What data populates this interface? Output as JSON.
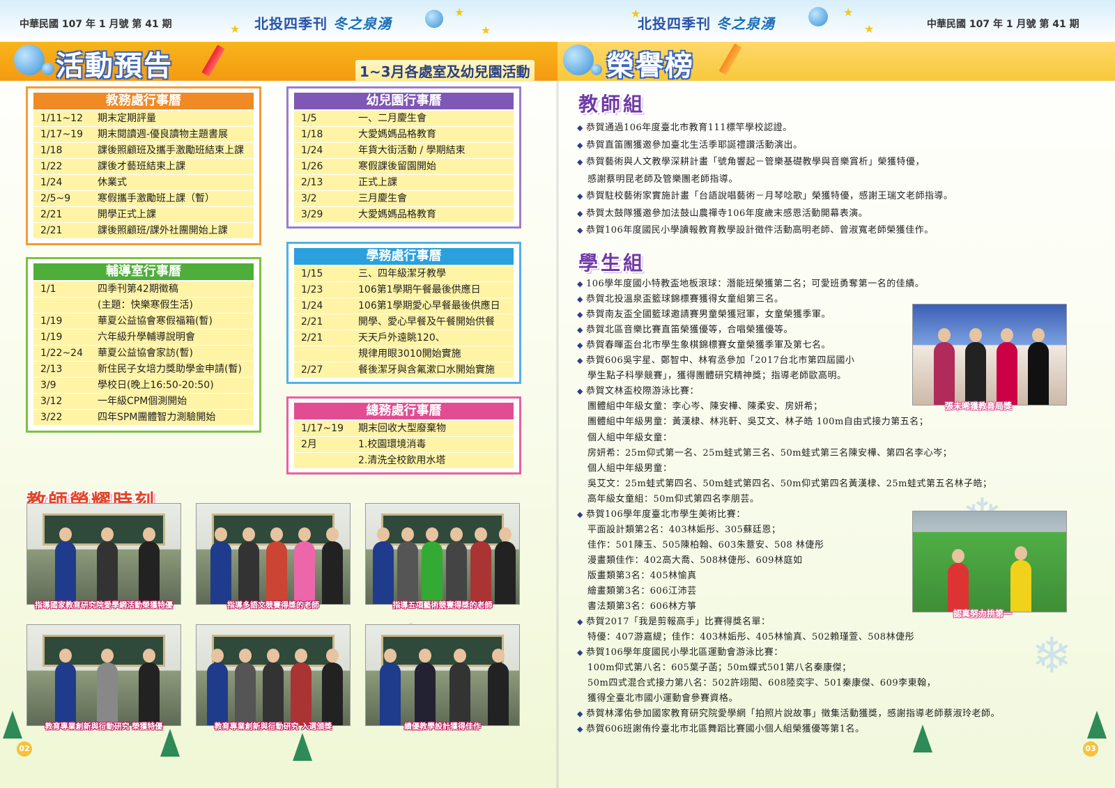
{
  "header": {
    "issue": "中華民國 107 年 1 月號 第 41 期",
    "magazine": "北投四季刊",
    "magazine_sub": "冬之泉湧"
  },
  "left": {
    "banner_title": "活動預告",
    "banner_sub": "1~3月各處室及幼兒園活動",
    "calendars": {
      "jiaowu": {
        "title": "教務處行事曆",
        "rows": [
          {
            "d": "1/11~12",
            "e": "期末定期評量"
          },
          {
            "d": "1/17~19",
            "e": "期末閱讀週-優良讀物主題書展"
          },
          {
            "d": "1/18",
            "e": "課後照顧班及攜手激勵班結束上課"
          },
          {
            "d": "1/22",
            "e": "課後才藝班結束上課"
          },
          {
            "d": "1/24",
            "e": "休業式"
          },
          {
            "d": "2/5~9",
            "e": "寒假攜手激勵班上課（暫）"
          },
          {
            "d": "2/21",
            "e": "開學正式上課"
          },
          {
            "d": "2/21",
            "e": "課後照顧班/課外社團開始上課"
          }
        ]
      },
      "fudao": {
        "title": "輔導室行事曆",
        "rows": [
          {
            "d": "1/1",
            "e": "四季刊第42期徵稿"
          },
          {
            "d": "",
            "e": "(主題：快樂寒假生活)"
          },
          {
            "d": "1/19",
            "e": "華夏公益協會寒假福箱(暫)"
          },
          {
            "d": "1/19",
            "e": "六年級升學輔導說明會"
          },
          {
            "d": "1/22~24",
            "e": "華夏公益協會家訪(暫)"
          },
          {
            "d": "2/13",
            "e": "新住民子女培力獎助學金申請(暫)"
          },
          {
            "d": "3/9",
            "e": "學校日(晚上16:50-20:50)"
          },
          {
            "d": "3/12",
            "e": "一年級CPM個測開始"
          },
          {
            "d": "3/22",
            "e": "四年SPM團體智力測驗開始"
          }
        ]
      },
      "youer": {
        "title": "幼兒園行事曆",
        "rows": [
          {
            "d": "1/5",
            "e": "一、二月慶生會"
          },
          {
            "d": "1/18",
            "e": "大愛媽媽品格教育"
          },
          {
            "d": "1/24",
            "e": "年貨大街活動 / 學期結束"
          },
          {
            "d": "1/26",
            "e": "寒假課後留園開始"
          },
          {
            "d": "2/13",
            "e": "正式上課"
          },
          {
            "d": "3/2",
            "e": "三月慶生會"
          },
          {
            "d": "3/29",
            "e": "大愛媽媽品格教育"
          }
        ]
      },
      "xuewu": {
        "title": "學務處行事曆",
        "rows": [
          {
            "d": "1/15",
            "e": "三、四年級潔牙教學"
          },
          {
            "d": "1/23",
            "e": "106第1學期午餐最後供應日"
          },
          {
            "d": "1/24",
            "e": "106第1學期愛心早餐最後供應日"
          },
          {
            "d": "2/21",
            "e": "開學、愛心早餐及午餐開始供餐"
          },
          {
            "d": "2/21",
            "e": "天天戶外遠眺120、"
          },
          {
            "d": "",
            "e": "規律用眼3010開始實施"
          },
          {
            "d": "2/27",
            "e": "餐後潔牙與含氟漱口水開始實施"
          }
        ]
      },
      "zongwu": {
        "title": "總務處行事曆",
        "rows": [
          {
            "d": "1/17~19",
            "e": "期末回收大型廢棄物"
          },
          {
            "d": "2月",
            "e": "1.校園環境消毒"
          },
          {
            "d": "",
            "e": "2.清洗全校飲用水塔"
          }
        ]
      }
    },
    "honor_title": "教師榮耀時刻",
    "photos": [
      {
        "caption": "指導國家教育研究院愛學網活動榮獲特優"
      },
      {
        "caption": "指導多語文競賽得獎的老師"
      },
      {
        "caption": "指導五項藝術競賽得獎的老師"
      },
      {
        "caption": "教育專業創新與行動研究 榮獲特優"
      },
      {
        "caption": "教育專業創新與行動研究 入選頒獎"
      },
      {
        "caption": "績優教學設計獲得佳作"
      }
    ],
    "page_number": "02"
  },
  "right": {
    "banner_title": "榮譽榜",
    "teacher_title": "教師組",
    "teacher_lines": [
      {
        "t": "恭賀通過106年度臺北市教育111標竿學校認證。",
        "b": true
      },
      {
        "t": "恭賀直笛團獲邀參加臺北生活季耶誕禮讚活動演出。",
        "b": true
      },
      {
        "t": "恭賀藝術與人文教學深耕計畫「號角響起－管樂基礎教學與音樂賞析」榮獲特優，",
        "b": true
      },
      {
        "t": "感謝蔡明昆老師及管樂團老師指導。",
        "b": false
      },
      {
        "t": "恭賀駐校藝術家實施計畫「台語說唱藝術－月琴唸歌」榮獲特優，感謝王瑞文老師指導。",
        "b": true
      },
      {
        "t": "恭賀太鼓隊獲邀參加法鼓山農禪寺106年度歲末感恩活動開幕表演。",
        "b": true
      },
      {
        "t": "恭賀106年度國民小學讀報教育教學設計徵件活動高明老師、曾淑寬老師榮獲佳作。",
        "b": true
      }
    ],
    "student_title": "學生組",
    "student_lines": [
      {
        "t": "106學年度國小特教盃地板滾球：潛能班榮獲第二名；可愛班勇奪第一名的佳績。",
        "b": true
      },
      {
        "t": "恭賀北投溫泉盃籃球錦標賽獲得女童組第三名。",
        "b": true
      },
      {
        "t": "恭賀南友盃全國籃球邀請賽男童榮獲冠軍，女童榮獲季軍。",
        "b": true
      },
      {
        "t": "恭賀北區音樂比賽直笛榮獲優等，合唱榮獲優等。",
        "b": true
      },
      {
        "t": "恭賀春暉盃台北市學生象棋錦標賽女童榮獲季軍及第七名。",
        "b": true
      },
      {
        "t": "恭賀606吳宇星、鄭智中、林宥丞參加「2017台北市第四屆國小",
        "b": true
      },
      {
        "t": "學生點子科學競賽」，獲得團體研究精神獎；指導老師歐高明。",
        "b": false
      },
      {
        "t": "恭賀文林盃校際游泳比賽：",
        "b": true
      },
      {
        "t": "團體組中年級女童：李心岑、陳安樺、陳柔安、房妍希；",
        "b": false
      },
      {
        "t": "團體組中年級男童：黃漢棣、林兆軒、吳艾文、林子皓 100m自由式接力第五名；",
        "b": false
      },
      {
        "t": "個人組中年級女童：",
        "b": false
      },
      {
        "t": "房妍希：25m仰式第一名、25m蛙式第三名、50m蛙式第三名陳安樺、第四名李心岑；",
        "b": false
      },
      {
        "t": "個人組中年級男童：",
        "b": false
      },
      {
        "t": "吳艾文：25m蛙式第四名、50m蛙式第四名、50m仰式第四名黃漢棣、25m蛙式第五名林子皓；",
        "b": false
      },
      {
        "t": "高年級女童組：50m仰式第四名李朋芸。",
        "b": false
      },
      {
        "t": "恭賀106學年度臺北市學生美術比賽：",
        "b": true
      },
      {
        "t": "平面設計類第2名：403林姤彤、305蘇廷恩；",
        "b": false
      },
      {
        "t": "佳作：501陳玉、505陳柏翰、603朱薏安、508 林倢彤",
        "b": false
      },
      {
        "t": "漫畫類佳作：402高大喬、508林倢彤、609林庭如",
        "b": false
      },
      {
        "t": "版畫類第3名：405林愉真",
        "b": false
      },
      {
        "t": "繪畫類第3名：606江沛芸",
        "b": false
      },
      {
        "t": "書法類第3名：606林方箏",
        "b": false
      },
      {
        "t": "恭賀2017「我是剪報高手」比賽得獎名單：",
        "b": true
      },
      {
        "t": "特優：407游嘉緹；佳作：403林姤彤、405林愉真、502賴瑾萱、508林倢彤",
        "b": false
      },
      {
        "t": "恭賀106學年度國民小學北區運動會游泳比賽：",
        "b": true
      },
      {
        "t": "100m仰式第八名：605葉子菡；50m蝶式501第八名秦康傑；",
        "b": false
      },
      {
        "t": "50m四式混合式接力第八名：502許翊閎、608陸奕宇、501秦康傑、609李東翰，",
        "b": false
      },
      {
        "t": "獲得全臺北市國小運動會參賽資格。",
        "b": false
      },
      {
        "t": "恭賀林澤佑參加國家教育研究院愛學網「拍照片說故事」徵集活動獲獎，感謝指導老師蔡淑玲老師。",
        "b": true
      },
      {
        "t": "恭賀606班謝侑伶臺北市北區舞蹈比賽國小個人組榮獲優等第1名。",
        "b": true
      }
    ],
    "photo1_caption": "張未晞獲教育局獎",
    "photo2_caption": "認真努力拚第一",
    "page_number": "03"
  }
}
